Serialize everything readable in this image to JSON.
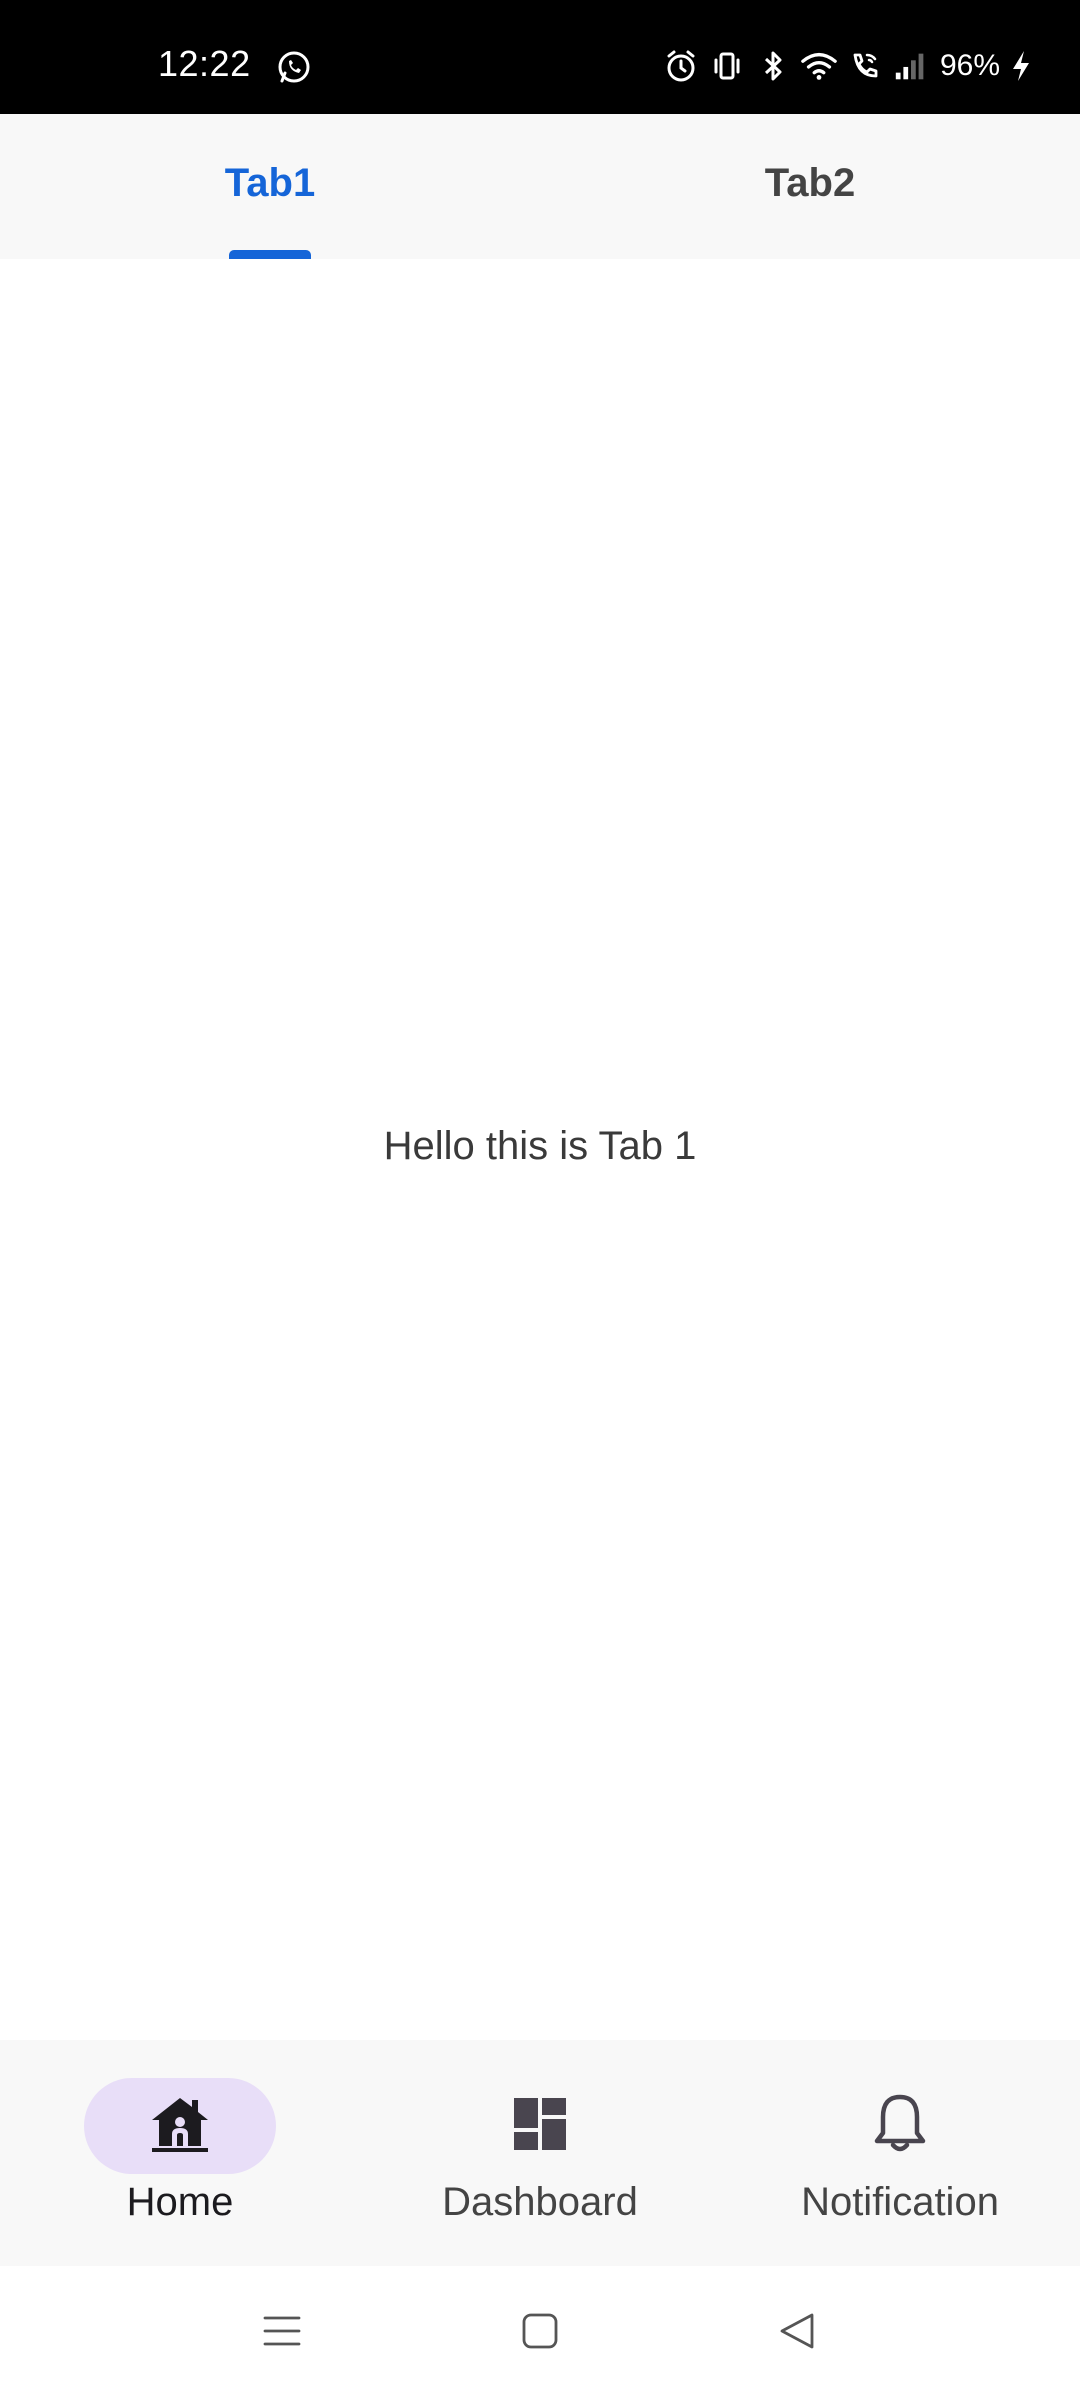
{
  "status_bar": {
    "time": "12:22",
    "battery": "96%",
    "icons": [
      "whatsapp-icon",
      "alarm-icon",
      "vibrate-icon",
      "bluetooth-icon",
      "wifi-icon",
      "wifi-calling-icon",
      "signal-icon",
      "charging-icon"
    ]
  },
  "tabs": [
    {
      "label": "Tab1",
      "selected": true
    },
    {
      "label": "Tab2",
      "selected": false
    }
  ],
  "content": {
    "text": "Hello this is Tab 1"
  },
  "bottom_nav": {
    "items": [
      {
        "label": "Home",
        "icon": "home-icon",
        "selected": true
      },
      {
        "label": "Dashboard",
        "icon": "dashboard-icon",
        "selected": false
      },
      {
        "label": "Notification",
        "icon": "bell-icon",
        "selected": false
      }
    ]
  },
  "colors": {
    "accent": "#1565d8",
    "selected_pill": "#e8def8",
    "bar_background": "#f8f8f8"
  }
}
